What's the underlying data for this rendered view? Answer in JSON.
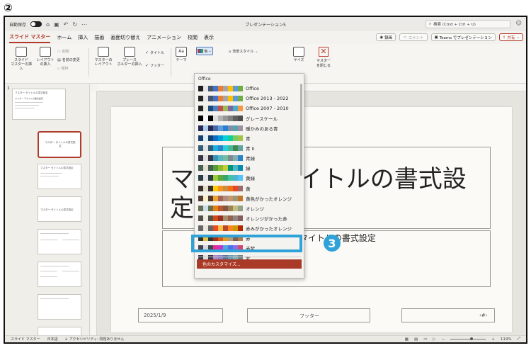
{
  "step_marker": "②",
  "callout_number": "3",
  "titlebar": {
    "autosave": "自動保存",
    "window_title": "プレゼンテーション5",
    "search_placeholder": "検索 (Cmd + Ctrl + U)"
  },
  "tabs": [
    "スライド マスター",
    "ホーム",
    "挿入",
    "描画",
    "画面切り替え",
    "アニメーション",
    "校閲",
    "表示"
  ],
  "tabs_right": {
    "record": "録画",
    "comment": "コメント",
    "teams": "Teams でプレゼンテーション",
    "share": "共有"
  },
  "ribbon": {
    "insert_master": "スライド\nマスターの挿入",
    "insert_layout": "レイアウト\nの挿入",
    "delete": "削除",
    "rename": "名前の変更",
    "preserve": "保持",
    "master_layout": "マスターの\nレイアウト",
    "insert_placeholder": "プレース\nホルダーの挿入",
    "title_check": "タイトル",
    "footer_check": "フッター",
    "theme": "テーマ",
    "colors": "色",
    "background_styles": "背景スタイル",
    "slide_size": "サイズ",
    "close_master": "マスター\nを閉じる"
  },
  "thumbnails": {
    "first_title": "マスター タイトルの書式設定",
    "sub_title": "マスター テキストの書式設定",
    "selected_title": "マスター タイトルの書式設定",
    "third_title": "マスター タイトルの書式設定",
    "fourth_title": "マスター タイトルの書式設定"
  },
  "slide": {
    "title": "マスター タイトルの書式設定",
    "subtitle": "マスター サブタイトルの書式設定",
    "date": "2025/1/9",
    "footer": "フッター",
    "page": "‹#›"
  },
  "dropdown": {
    "header": "Office",
    "customize": "色のカスタマイズ...",
    "palettes": [
      {
        "name": "Office",
        "colors": [
          "#1f1f1f",
          "#e7e6e6",
          "#44546a",
          "#4472c4",
          "#ed7d31",
          "#a5a5a5",
          "#ffc000",
          "#5b9bd5",
          "#70ad47"
        ]
      },
      {
        "name": "Office 2013 - 2022",
        "colors": [
          "#222222",
          "#e7e6e6",
          "#44546a",
          "#4472c4",
          "#ed7d31",
          "#a5a5a5",
          "#ffc000",
          "#5b9bd5",
          "#70ad47"
        ]
      },
      {
        "name": "Office 2007 - 2010",
        "colors": [
          "#222222",
          "#eeece1",
          "#1f497d",
          "#4f81bd",
          "#c0504d",
          "#9bbb59",
          "#8064a2",
          "#4bacc6",
          "#f79646"
        ]
      },
      {
        "name": "グレースケール",
        "colors": [
          "#000000",
          "#f8f8f8",
          "#000000",
          "#dddddd",
          "#b2b2b2",
          "#969696",
          "#808080",
          "#5f5f5f",
          "#4d4d4d"
        ]
      },
      {
        "name": "暖かみのある青",
        "colors": [
          "#242852",
          "#acccea",
          "#242852",
          "#4a66ac",
          "#629dd1",
          "#297fd5",
          "#7f8fa9",
          "#5aa2ae",
          "#9d90a0"
        ]
      },
      {
        "name": "青",
        "colors": [
          "#17406d",
          "#dbeff9",
          "#17406d",
          "#0f6fc6",
          "#009dd9",
          "#0bd0d9",
          "#10cf9b",
          "#7cca62",
          "#a5c249"
        ]
      },
      {
        "name": "青 II",
        "colors": [
          "#335b74",
          "#dfe3e5",
          "#335b74",
          "#1cade4",
          "#2683c6",
          "#27ced7",
          "#42ba97",
          "#3e8853",
          "#62a39f"
        ]
      },
      {
        "name": "青緑",
        "colors": [
          "#373545",
          "#dedede",
          "#373545",
          "#3494ba",
          "#58b6c0",
          "#75bda7",
          "#7a8c8e",
          "#84acb6",
          "#2683c6"
        ]
      },
      {
        "name": "緑",
        "colors": [
          "#455f51",
          "#e3ded1",
          "#455f51",
          "#549e39",
          "#8ab833",
          "#c0cf3a",
          "#029676",
          "#4ab5c4",
          "#0989b1"
        ]
      },
      {
        "name": "黄緑",
        "colors": [
          "#2c3c43",
          "#e3e3e3",
          "#2c3c43",
          "#99cb38",
          "#63a537",
          "#37a76f",
          "#44c1a3",
          "#4eb3cf",
          "#51c3f9"
        ]
      },
      {
        "name": "黄",
        "colors": [
          "#39302a",
          "#e5dec9",
          "#39302a",
          "#ffca08",
          "#f8931d",
          "#ce8d3e",
          "#ec7016",
          "#e64823",
          "#9c6a6a"
        ]
      },
      {
        "name": "黄色がかったオレンジ",
        "colors": [
          "#4e3b30",
          "#fbeec9",
          "#4e3b30",
          "#f0a22e",
          "#a5644e",
          "#b58b80",
          "#c3986d",
          "#a19574",
          "#c17529"
        ]
      },
      {
        "name": "オレンジ",
        "colors": [
          "#637052",
          "#ccddea",
          "#637052",
          "#e48312",
          "#bd582c",
          "#865640",
          "#9b8357",
          "#c2bc80",
          "#94a088"
        ]
      },
      {
        "name": "オレンジがかった赤",
        "colors": [
          "#505046",
          "#eeece1",
          "#505046",
          "#d34817",
          "#9b2d1f",
          "#a28e6a",
          "#956251",
          "#918485",
          "#855d5d"
        ]
      },
      {
        "name": "赤みがかったオレンジ",
        "colors": [
          "#696464",
          "#e9e5dc",
          "#696464",
          "#e84c22",
          "#ffbd47",
          "#b64926",
          "#ff8427",
          "#cc9900",
          "#b22600"
        ]
      },
      {
        "name": "赤",
        "colors": [
          "#323232",
          "#e5c243",
          "#323232",
          "#a5300f",
          "#d55816",
          "#e19825",
          "#b19c7d",
          "#7f5f52",
          "#b27d49"
        ]
      },
      {
        "name": "赤紫",
        "colors": [
          "#454551",
          "#d8d9dc",
          "#454551",
          "#e32d91",
          "#c830cc",
          "#4ea6dc",
          "#4775e7",
          "#8971e1",
          "#d54773"
        ]
      },
      {
        "name": "紫",
        "colors": [
          "#373545",
          "#e3e3e3",
          "#373545",
          "#ad84c6",
          "#8784c7",
          "#5d739a",
          "#6997af",
          "#84acb6",
          "#6f8183"
        ]
      }
    ]
  },
  "statusbar": {
    "view": "スライド マスター",
    "language": "日本語",
    "accessibility": "アクセシビリティ: 問題ありません",
    "zoom": "119%"
  }
}
